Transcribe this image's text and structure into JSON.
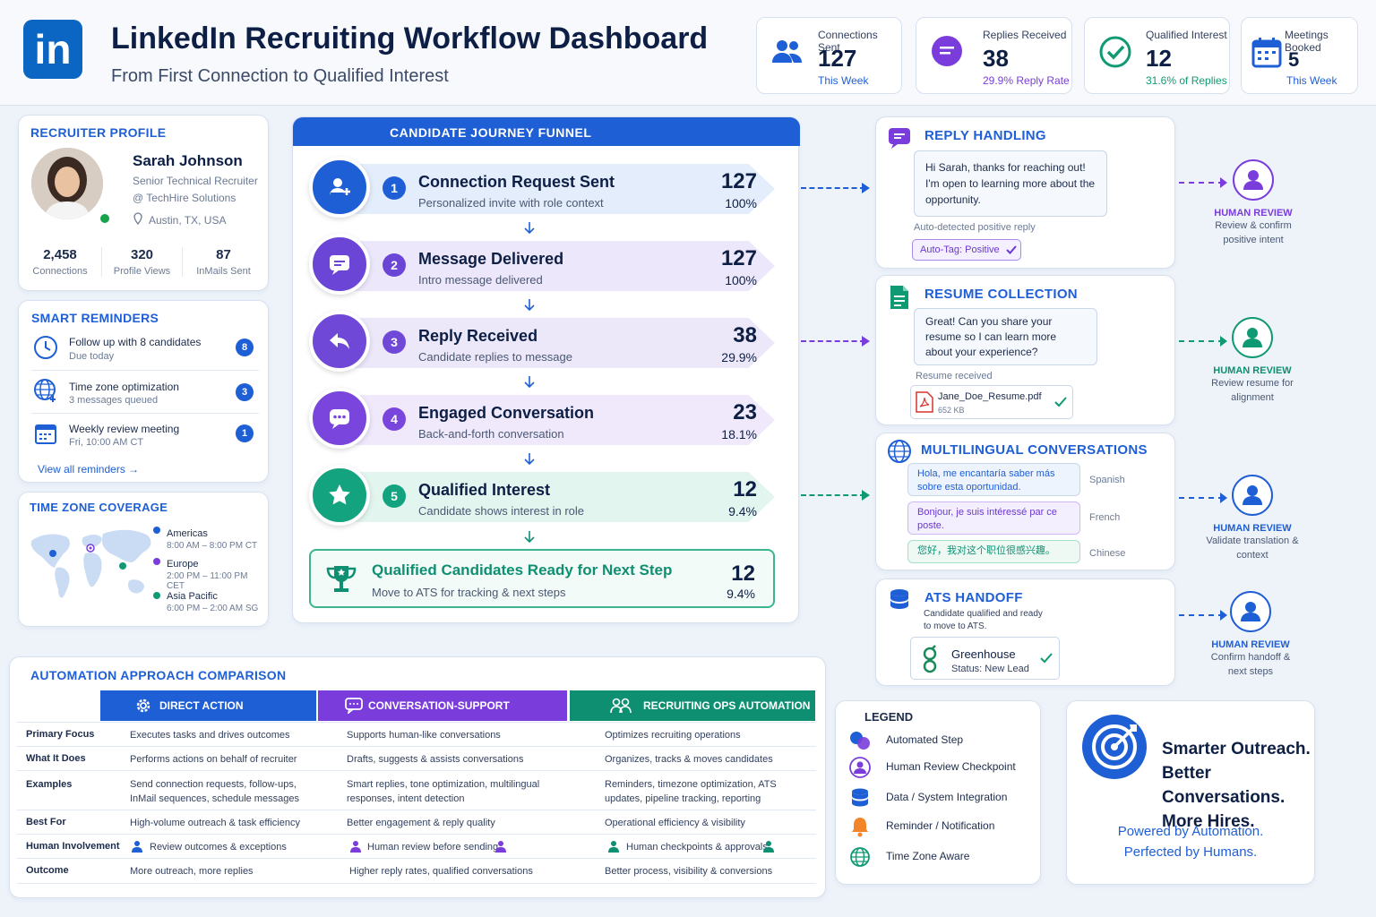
{
  "header": {
    "logo_text": "in",
    "title": "LinkedIn Recruiting Workflow Dashboard",
    "subtitle": "From First Connection to Qualified Interest"
  },
  "kpis": [
    {
      "label": "Connections Sent",
      "value": "127",
      "sub": "This Week",
      "icon": "people-icon",
      "color": "#1f5fd6"
    },
    {
      "label": "Replies Received",
      "value": "38",
      "sub": "29.9% Reply Rate",
      "icon": "chat-bubble-icon",
      "color": "#7a3ddc"
    },
    {
      "label": "Qualified Interest",
      "value": "12",
      "sub": "31.6% of Replies",
      "icon": "check-circle-icon",
      "color": "#0f9a73"
    },
    {
      "label": "Meetings Booked",
      "value": "5",
      "sub": "This Week",
      "icon": "calendar-icon",
      "color": "#1f5fd6"
    }
  ],
  "profile": {
    "section_title": "RECRUITER PROFILE",
    "name": "Sarah Johnson",
    "role": "Senior Technical Recruiter",
    "company": "@ TechHire Solutions",
    "location": "Austin, TX, USA",
    "stats": [
      {
        "value": "2,458",
        "label": "Connections"
      },
      {
        "value": "320",
        "label": "Profile Views"
      },
      {
        "value": "87",
        "label": "InMails Sent"
      }
    ]
  },
  "reminders": {
    "section_title": "SMART REMINDERS",
    "items": [
      {
        "title": "Follow up with 8 candidates",
        "sub": "Due today",
        "count": "8",
        "icon": "clock-icon"
      },
      {
        "title": "Time zone optimization",
        "sub": "3 messages queued",
        "count": "3",
        "icon": "globe-icon"
      },
      {
        "title": "Weekly review meeting",
        "sub": "Fri, 10:00 AM CT",
        "count": "1",
        "icon": "calendar-icon"
      }
    ],
    "view_all": "View all reminders →"
  },
  "timezones": {
    "section_title": "TIME ZONE COVERAGE",
    "zones": [
      {
        "region": "Americas",
        "hours": "8:00 AM – 8:00 PM CT",
        "color": "#1f5fd6"
      },
      {
        "region": "Europe",
        "hours": "2:00 PM – 11:00 PM CET",
        "color": "#7a3ddc"
      },
      {
        "region": "Asia Pacific",
        "hours": "6:00 PM – 2:00 AM SG",
        "color": "#0f9a73"
      }
    ]
  },
  "funnel": {
    "section_title": "CANDIDATE JOURNEY FUNNEL",
    "stages": [
      {
        "no": "1",
        "title": "Connection Request Sent",
        "desc": "Personalized invite with role context",
        "value": "127",
        "pct": "100%",
        "color": "#1f5fd6",
        "band": "#e4edfb",
        "icon": "add-user-icon"
      },
      {
        "no": "2",
        "title": "Message Delivered",
        "desc": "Intro message delivered",
        "value": "127",
        "pct": "100%",
        "color": "#6a45d6",
        "band": "#ece7fb",
        "icon": "message-icon"
      },
      {
        "no": "3",
        "title": "Reply Received",
        "desc": "Candidate replies to message",
        "value": "38",
        "pct": "29.9%",
        "color": "#7048d8",
        "band": "#ece8fa",
        "icon": "reply-icon"
      },
      {
        "no": "4",
        "title": "Engaged Conversation",
        "desc": "Back-and-forth conversation",
        "value": "23",
        "pct": "18.1%",
        "color": "#7a45dc",
        "band": "#efe9fb",
        "icon": "chat-dots-icon"
      },
      {
        "no": "5",
        "title": "Qualified Interest",
        "desc": "Candidate shows interest in role",
        "value": "12",
        "pct": "9.4%",
        "color": "#14a37f",
        "band": "#e2f5ef",
        "icon": "star-icon"
      }
    ],
    "final": {
      "title": "Qualified Candidates Ready for Next Step",
      "desc": "Move to ATS for tracking & next steps",
      "value": "12",
      "pct": "9.4%"
    }
  },
  "reply_handling": {
    "title": "REPLY HANDLING",
    "message": "Hi Sarah, thanks for reaching out! I'm open to learning more about the opportunity.",
    "note": "Auto-detected positive reply",
    "tag": "Auto-Tag: Positive"
  },
  "resume_collection": {
    "title": "RESUME COLLECTION",
    "message": "Great! Can you share your resume so I can learn more about your experience?",
    "note": "Resume received",
    "file_name": "Jane_Doe_Resume.pdf",
    "file_size": "652 KB"
  },
  "multilingual": {
    "title": "MULTILINGUAL CONVERSATIONS",
    "messages": [
      {
        "text": "Hola, me encantaría saber más sobre esta oportunidad.",
        "lang": "Spanish"
      },
      {
        "text": "Bonjour, je suis intéressé par ce poste.",
        "lang": "French"
      },
      {
        "text": "您好，我对这个职位很感兴趣。",
        "lang": "Chinese"
      }
    ]
  },
  "ats_handoff": {
    "title": "ATS HANDOFF",
    "desc": "Candidate qualified and ready to move to ATS.",
    "system": "Greenhouse",
    "status": "Status: New Lead"
  },
  "human_reviews": [
    {
      "title": "HUMAN REVIEW",
      "desc": "Review & confirm positive intent",
      "color": "#7a3ddc"
    },
    {
      "title": "HUMAN REVIEW",
      "desc": "Review resume for alignment",
      "color": "#0f9a73"
    },
    {
      "title": "HUMAN REVIEW",
      "desc": "Validate translation & context",
      "color": "#1f5fd6"
    },
    {
      "title": "HUMAN REVIEW",
      "desc": "Confirm handoff & next steps",
      "color": "#1f5fd6"
    }
  ],
  "comparison": {
    "title": "AUTOMATION APPROACH COMPARISON",
    "columns": [
      {
        "label": "DIRECT ACTION AUTOMATION",
        "color": "#1f5fd6",
        "icon": "gear-icon"
      },
      {
        "label": "CONVERSATION-SUPPORT AUTOMATION",
        "color": "#7a3ddc",
        "icon": "chat-bubble-icon"
      },
      {
        "label": "RECRUITING  OPS  AUTOMATION",
        "color": "#0f8f72",
        "icon": "team-icon"
      }
    ],
    "rows": [
      {
        "label": "Primary Focus",
        "cells": [
          "Executes tasks and drives outcomes",
          "Supports human-like conversations",
          "Optimizes recruiting operations"
        ]
      },
      {
        "label": "What It Does",
        "cells": [
          "Performs actions on behalf of recruiter",
          "Drafts, suggests & assists conversations",
          "Organizes, tracks & moves candidates"
        ]
      },
      {
        "label": "Examples",
        "cells": [
          "Send connection requests, follow-ups, InMail sequences, schedule messages",
          "Smart replies, tone optimization, multilingual responses, intent detection",
          "Reminders, timezone optimization, ATS updates, pipeline tracking, reporting"
        ]
      },
      {
        "label": "Best For",
        "cells": [
          "High-volume outreach & task efficiency",
          "Better engagement & reply quality",
          "Operational efficiency & visibility"
        ]
      },
      {
        "label": "Human Involvement",
        "cells": [
          "Review outcomes & exceptions",
          "Human review before sending",
          "Human checkpoints & approvals"
        ]
      },
      {
        "label": "Outcome",
        "cells": [
          "More outreach, more replies",
          "Higher reply rates, qualified conversations",
          "Better process, visibility & conversions"
        ]
      }
    ]
  },
  "legend": {
    "title": "LEGEND",
    "items": [
      {
        "label": "Automated Step",
        "icon": "automated-step-icon"
      },
      {
        "label": "Human Review Checkpoint",
        "icon": "person-icon"
      },
      {
        "label": "Data / System Integration",
        "icon": "database-icon"
      },
      {
        "label": "Reminder / Notification",
        "icon": "bell-icon"
      },
      {
        "label": "Time Zone Aware",
        "icon": "globe-icon"
      }
    ]
  },
  "promo": {
    "line1": "Smarter Outreach.",
    "line2": "Better Conversations.",
    "line3": "More Hires.",
    "tag1": "Powered by Automation.",
    "tag2": "Perfected by Humans."
  }
}
